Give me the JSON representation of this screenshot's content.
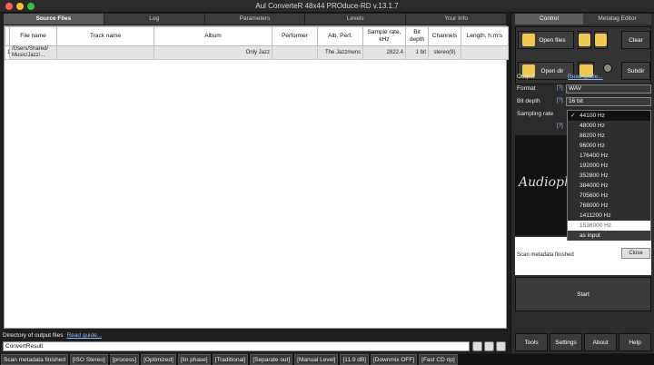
{
  "window": {
    "title": "Aul ConverteR 48x44 PROduce-RD v.13.1.7"
  },
  "left_tabs": [
    "Source Files",
    "Log",
    "Parameters",
    "Levels",
    "Your Info"
  ],
  "table": {
    "headers": [
      "File name",
      "Track name",
      "Album",
      "Performer",
      "Alb. Perf.",
      "Sample rate, kHz",
      "Bit depth",
      "Channels",
      "Length, h:m:s"
    ],
    "rows": [
      {
        "num": "1",
        "file": "/Users/Shared/\nMusic/Jazz/...",
        "track": "",
        "album": "Only Jazz",
        "performer": "",
        "alb_perf": "The Jazzmens",
        "rate": "2822.4",
        "bits": "1 bit",
        "channels": "stereo(9)",
        "length": ""
      }
    ]
  },
  "output_dir": {
    "label": "Directory of output files",
    "guide": "Read guide...",
    "value": "ConvertResult"
  },
  "status_items": [
    "Scan metadata finished",
    "[ISO Stereo]",
    "[process]",
    "[Optimized]",
    "[lin phase]",
    "[Traditional]",
    "[Separate out]",
    "[Manual Level]",
    "[11.9 dB]",
    "[Downmix OFF]",
    "[Fast CD rip]"
  ],
  "right_tabs": [
    "Control",
    "Metatag Editor"
  ],
  "buttons": {
    "open_files": "Open files",
    "clear": "Clear",
    "open_dir": "Open dir",
    "subdir": "Subdir"
  },
  "output": {
    "label": "Output",
    "guide": "Read guide...",
    "format_label": "Format",
    "format_value": "WAV",
    "bit_depth_label": "Bit depth",
    "bit_depth_value": "16 bit",
    "sampling_label": "Sampling rate",
    "q": "[?]"
  },
  "sample_rates": [
    "44100 Hz",
    "48000 Hz",
    "88200 Hz",
    "96000 Hz",
    "176400 Hz",
    "192000 Hz",
    "352800 Hz",
    "384000 Hz",
    "705600 Hz",
    "768000 Hz",
    "1411200 Hz",
    "1536000 Hz",
    "as input"
  ],
  "selected_rate": "44100 Hz",
  "preview_text": "Audiophi",
  "message": {
    "text": "Scan metadata finished",
    "close": "Close"
  },
  "start_label": "Start",
  "bottom_buttons": [
    "Tools",
    "Settings",
    "About",
    "Help"
  ]
}
